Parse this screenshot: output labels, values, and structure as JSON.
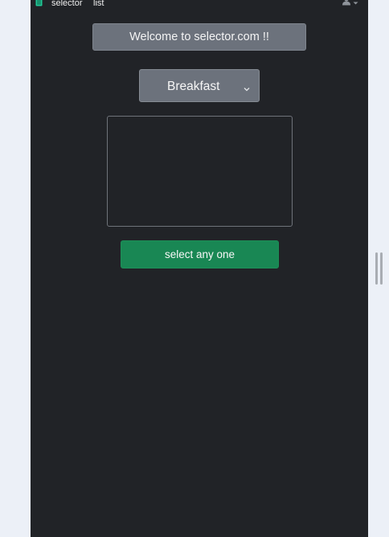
{
  "navbar": {
    "brand": "selector",
    "link": "list",
    "brand_icon": "book-icon",
    "user_icon": "user-icon",
    "dropdown_icon": "chevron-down-icon"
  },
  "welcome": {
    "text": "Welcome to selector.com !!"
  },
  "meal_select": {
    "selected": "Breakfast",
    "caret_icon": "chevron-down-icon"
  },
  "result_box": {
    "content": ""
  },
  "action_button": {
    "label": "select any one"
  },
  "colors": {
    "panel_bg": "#212327",
    "page_bg": "#ecf0f7",
    "banner_bg": "#6c727c",
    "button_green": "#198754",
    "brand_icon_green": "#20c997"
  }
}
